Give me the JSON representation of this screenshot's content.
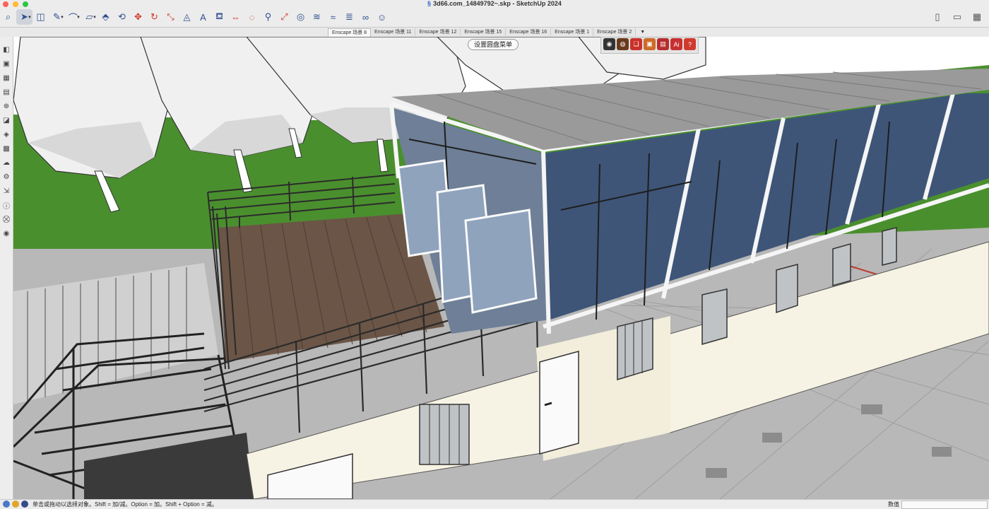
{
  "window": {
    "title": "3d66.com_14849792~.skp - SketchUp 2024",
    "title_icon": "sketchup-logo-icon"
  },
  "toolbar": {
    "tools": [
      {
        "name": "search-icon",
        "glyph": "⌕"
      },
      {
        "name": "select-tool-icon",
        "glyph": "➤",
        "dropdown": true,
        "selected": true
      },
      {
        "name": "eraser-icon",
        "glyph": "◫"
      },
      {
        "name": "pencil-icon",
        "glyph": "✎",
        "dropdown": true
      },
      {
        "name": "arc-tool-icon",
        "glyph": "⌒",
        "dropdown": true
      },
      {
        "name": "rectangle-tool-icon",
        "glyph": "▱",
        "dropdown": true
      },
      {
        "name": "push-pull-icon",
        "glyph": "⬘"
      },
      {
        "name": "offset-icon",
        "glyph": "⟲"
      },
      {
        "name": "move-icon",
        "glyph": "✥",
        "red": true
      },
      {
        "name": "rotate-icon",
        "glyph": "↻",
        "red": true
      },
      {
        "name": "scale-icon",
        "glyph": "⤡",
        "red": true
      },
      {
        "name": "tape-measure-icon",
        "glyph": "◬"
      },
      {
        "name": "text-tool-icon",
        "glyph": "A"
      },
      {
        "name": "paint-bucket-icon",
        "glyph": "⛾"
      },
      {
        "name": "section-plane-icon",
        "glyph": "⇔",
        "red": true
      },
      {
        "name": "orbit-icon",
        "glyph": "◌",
        "red": true
      },
      {
        "name": "zoom-icon",
        "glyph": "⚲"
      },
      {
        "name": "zoom-extents-icon",
        "glyph": "⤢",
        "red": true
      },
      {
        "name": "geo-location-icon",
        "glyph": "◎"
      },
      {
        "name": "sandbox-icon",
        "glyph": "≋"
      },
      {
        "name": "sandbox-smoove-icon",
        "glyph": "≈"
      },
      {
        "name": "sandbox-stamp-icon",
        "glyph": "≣"
      },
      {
        "name": "extension-warehouse-icon",
        "glyph": "∞"
      },
      {
        "name": "user-avatar-icon",
        "glyph": "☺"
      }
    ],
    "right": [
      {
        "name": "document-icon",
        "glyph": "▯"
      },
      {
        "name": "sidebar-toggle-icon",
        "glyph": "▭"
      },
      {
        "name": "grid-layout-icon",
        "glyph": "▦"
      }
    ]
  },
  "scenes": {
    "tabs": [
      "Enscape 场景 8",
      "Enscape 场景 11",
      "Enscape 场景 12",
      "Enscape 场景 15",
      "Enscape 场景 16",
      "Enscape 场景 1",
      "Enscape 场景 2"
    ],
    "active_index": 0,
    "more_glyph": "▼"
  },
  "viewport": {
    "pie_menu_label": "设置圆盘菜单",
    "colors": {
      "grass": "#4a8f2e",
      "road": "#b9b9b9",
      "deck": "#6b5546",
      "glass": "#3e5578",
      "wall": "#f7f3e4",
      "frame": "#ffffff",
      "roof": "#9a9a9a",
      "metal": "#2b2b2b",
      "sky": "#ffffff"
    }
  },
  "enscape_toolbar": [
    {
      "name": "enscape-start-icon",
      "glyph": "◉",
      "color": "#333333"
    },
    {
      "name": "enscape-sync-icon",
      "glyph": "◍",
      "color": "#6a3a1c"
    },
    {
      "name": "enscape-asset-icon",
      "glyph": "❏",
      "color": "#c8322b"
    },
    {
      "name": "enscape-screenshot-icon",
      "glyph": "▣",
      "color": "#cd6a2a"
    },
    {
      "name": "enscape-book-icon",
      "glyph": "▤",
      "color": "#b82d2d"
    },
    {
      "name": "enscape-ai-icon",
      "glyph": "Ai",
      "color": "#c73030"
    },
    {
      "name": "enscape-help-icon",
      "glyph": "?",
      "color": "#d03a2e"
    }
  ],
  "left_toolbar": [
    "camera-icon",
    "layers-icon",
    "components-icon",
    "file-icon",
    "add-location-icon",
    "shadow-icon",
    "materials-icon",
    "styles-icon",
    "cloud-icon",
    "settings-icon",
    "export-icon",
    "info-icon",
    "cart-icon",
    "profile-icon"
  ],
  "left_toolbar_glyphs": [
    "◧",
    "▣",
    "▦",
    "▤",
    "⊕",
    "◪",
    "◈",
    "▩",
    "☁",
    "⚙",
    "⇲",
    "ⓘ",
    "⛒",
    "◉"
  ],
  "statusbar": {
    "hint": "单击或拖动以选择对象。Shift = 加/减。Option = 加。Shift + Option = 减。",
    "measurements_label": "数值",
    "icon_colors": [
      "#4a78c9",
      "#e0a52a",
      "#334c8a"
    ]
  }
}
